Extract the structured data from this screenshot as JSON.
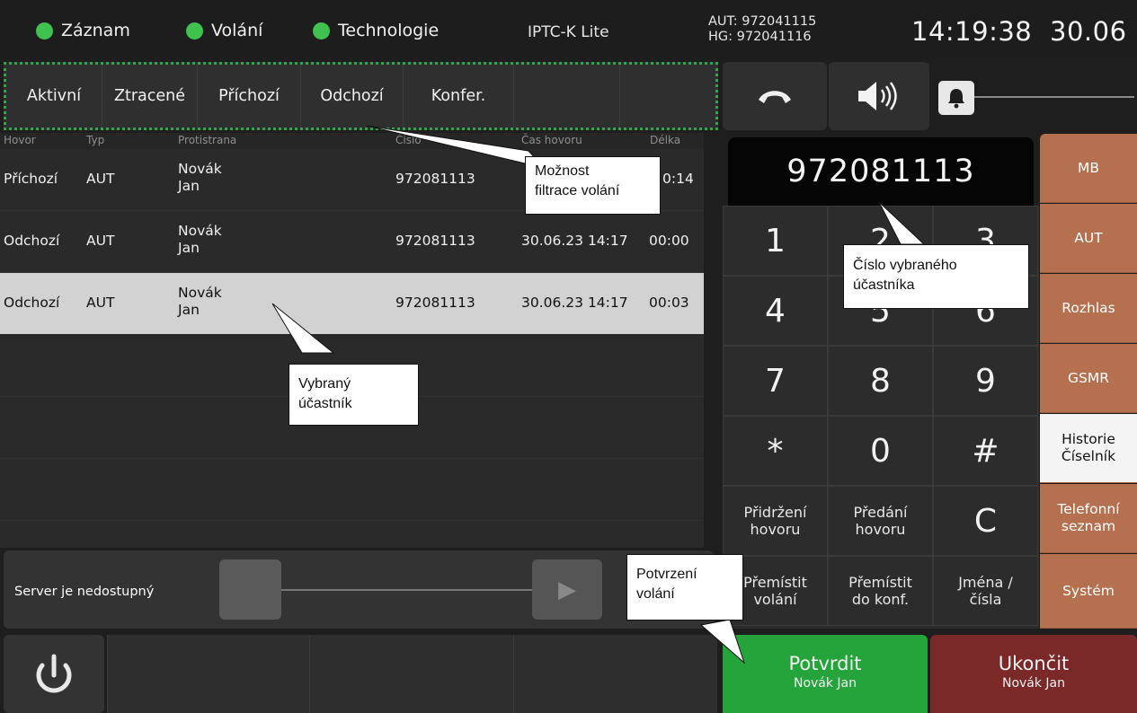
{
  "status": {
    "indicators": [
      {
        "label": "Záznam",
        "color": "#3fc24f"
      },
      {
        "label": "Volání",
        "color": "#3fc24f"
      },
      {
        "label": "Technologie",
        "color": "#3fc24f"
      }
    ],
    "system_name": "IPTC-K Lite",
    "aut_id": "AUT: 972041115",
    "hg_id": "HG: 972041116",
    "time": "14:19:38",
    "date": "30.06"
  },
  "tabs": [
    "Aktivní",
    "Ztracené",
    "Příchozí",
    "Odchozí",
    "Konfer.",
    "",
    ""
  ],
  "table": {
    "headers": [
      "Hovor",
      "Typ",
      "Protistrana",
      "Číslo",
      "Čas hovoru",
      "Délka"
    ],
    "rows": [
      {
        "direction": "Příchozí",
        "type": "AUT",
        "surname": "Novák",
        "name": "Jan",
        "number": "972081113",
        "time": "",
        "duration": "0:14"
      },
      {
        "direction": "Odchozí",
        "type": "AUT",
        "surname": "Novák",
        "name": "Jan",
        "number": "972081113",
        "time": "30.06.23 14:17",
        "duration": "00:00"
      },
      {
        "direction": "Odchozí",
        "type": "AUT",
        "surname": "Novák",
        "name": "Jan",
        "number": "972081113",
        "time": "30.06.23 14:17",
        "duration": "00:03"
      }
    ]
  },
  "server": {
    "status": "Server je nedostupný"
  },
  "controls": {
    "volume_level": 0.0
  },
  "dial": {
    "number": "972081113"
  },
  "keypad": {
    "keys": [
      "1",
      "2",
      "3",
      "4",
      "5",
      "6",
      "7",
      "8",
      "9",
      "*",
      "0",
      "#"
    ],
    "func": [
      {
        "l1": "Přidržení",
        "l2": "hovoru"
      },
      {
        "l1": "Předání",
        "l2": "hovoru"
      },
      {
        "l1": "C",
        "l2": ""
      },
      {
        "l1": "Přemístit",
        "l2": "volání"
      },
      {
        "l1": "Přemístit",
        "l2": "do konf."
      },
      {
        "l1": "Jména /",
        "l2": "čísla"
      }
    ]
  },
  "side_menu": [
    {
      "l1": "MB",
      "l2": ""
    },
    {
      "l1": "AUT",
      "l2": ""
    },
    {
      "l1": "Rozhlas",
      "l2": ""
    },
    {
      "l1": "GSMR",
      "l2": ""
    },
    {
      "l1": "Historie",
      "l2": "Číselník"
    },
    {
      "l1": "Telefonní",
      "l2": "seznam"
    },
    {
      "l1": "Systém",
      "l2": ""
    }
  ],
  "actions": {
    "confirm_label": "Potvrdit",
    "confirm_sub": "Novák Jan",
    "hangup_label": "Ukončit",
    "hangup_sub": "Novák Jan"
  },
  "callouts": {
    "filter": [
      "Možnost",
      "filtrace volání"
    ],
    "number": [
      "Číslo  vybraného",
      "účastníka"
    ],
    "selected": [
      "Vybraný",
      "účastník"
    ],
    "confirm": [
      "Potvrzení",
      "volání"
    ]
  }
}
